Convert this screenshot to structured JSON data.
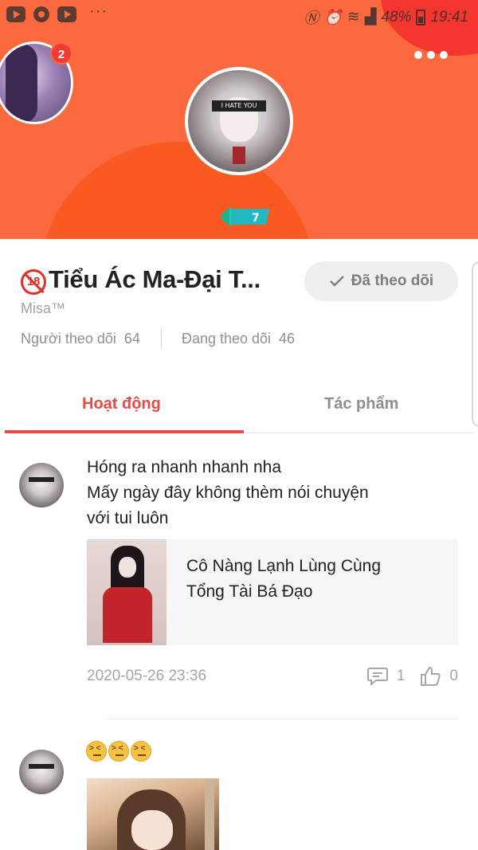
{
  "status_bar": {
    "battery": "48%",
    "time": "19:41",
    "left_icons": [
      "youtube-icon",
      "chrome-icon",
      "youtube-icon"
    ],
    "right_icons": [
      "nfc-icon",
      "alarm-icon",
      "wifi-icon",
      "signal-icon",
      "battery-icon"
    ]
  },
  "header": {
    "notification_count": "2",
    "avatar_band_text": "I HATE YOU",
    "level": "7",
    "colors": {
      "background": "#fb6a3f",
      "accent_circle": "#fa5a22",
      "corner_circle": "#f5352f"
    }
  },
  "profile": {
    "age_badge": "18",
    "name": "Tiểu Ác Ma-Đại T...",
    "username": "Misa™",
    "follow_button": "Đã theo dõi",
    "followers_label": "Người theo dõi",
    "followers_count": "64",
    "following_label": "Đang theo dõi",
    "following_count": "46"
  },
  "tabs": [
    {
      "label": "Hoạt động",
      "active": true
    },
    {
      "label": "Tác phẩm",
      "active": false
    }
  ],
  "feed": [
    {
      "text_lines": [
        "Hóng ra nhanh nhanh nha",
        "Mấy ngày đây không thèm nói chuyện",
        "với tui luôn"
      ],
      "book": {
        "title_lines": [
          "Cô Nàng Lạnh Lùng Cùng",
          "Tổng Tài Bá Đạo"
        ]
      },
      "date": "2020-05-26 23:36",
      "comments": "1",
      "likes": "0"
    },
    {
      "emojis": [
        "😖",
        "😖",
        "😖"
      ]
    }
  ],
  "accent_color": "#e84a45"
}
